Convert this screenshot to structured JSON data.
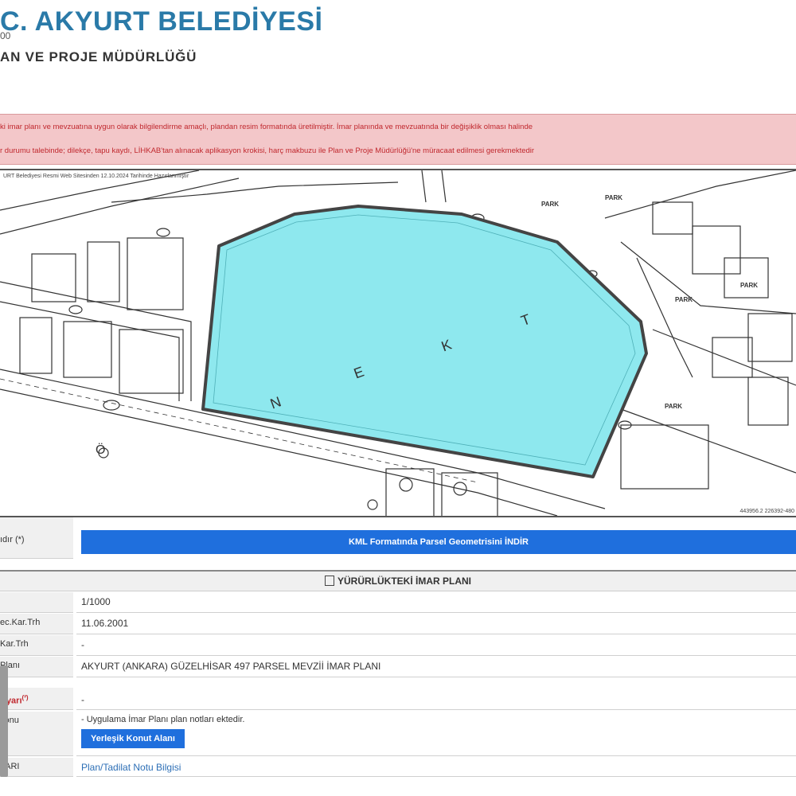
{
  "header": {
    "title": "C. AKYURT BELEDİYESİ",
    "seal_text": "00",
    "subtitle": "AN VE PROJE MÜDÜRLÜĞÜ"
  },
  "notice": {
    "line1": "ki imar planı ve mevzuatına uygun olarak bilgilendirme amaçlı, plandan resim formatında üretilmiştir. İmar planında ve mevzuatında bir değişiklik olması halinde",
    "line2": "r durumu talebinde; dilekçe, tapu kaydı, LİHKAB'tan alınacak aplikasyon krokisi, harç makbuzu ile Plan ve Proje Müdürlüğü'ne müracaat edilmesi gerekmektedir"
  },
  "map": {
    "caption": "URT Belediyesi Resmi Web Sitesinden 12.10.2024 Tarihinde Hazırlanmıştır",
    "labels": [
      "N",
      "E",
      "K",
      "T",
      "Ö"
    ],
    "park_labels": [
      "PARK",
      "PARK",
      "PARK",
      "PARK",
      "PARK"
    ],
    "coord_readout": "443956.2 226392-480",
    "parcel_color": "#8ee8ee",
    "parcel_border": "#444444"
  },
  "table": {
    "kml_label": "ıdır (*)",
    "kml_button": "KML Formatında Parsel Geometrisini İNDİR",
    "section_title": "YÜRÜRLÜKTEKİ İMAR PLANI",
    "rows": [
      {
        "label": "",
        "value": "1/1000"
      },
      {
        "label": "ec.Kar.Trh",
        "value": "11.06.2001"
      },
      {
        "label": "Kar.Trh",
        "value": "-"
      },
      {
        "label": "Planı",
        "value": "AKYURT (ANKARA) GÜZELHİSAR 497 PARSEL MEVZİİ İMAR PLANI"
      }
    ],
    "warning_label": "Uyarı",
    "warning_sup": "(²)",
    "warning_value": "-",
    "zone_label": "yonu",
    "zone_note": "- Uygulama İmar Planı plan notları ektedir.",
    "zone_button": "Yerleşik Konut Alanı",
    "notes_label": "LARI",
    "notes_link": "Plan/Tadilat Notu Bilgisi"
  }
}
